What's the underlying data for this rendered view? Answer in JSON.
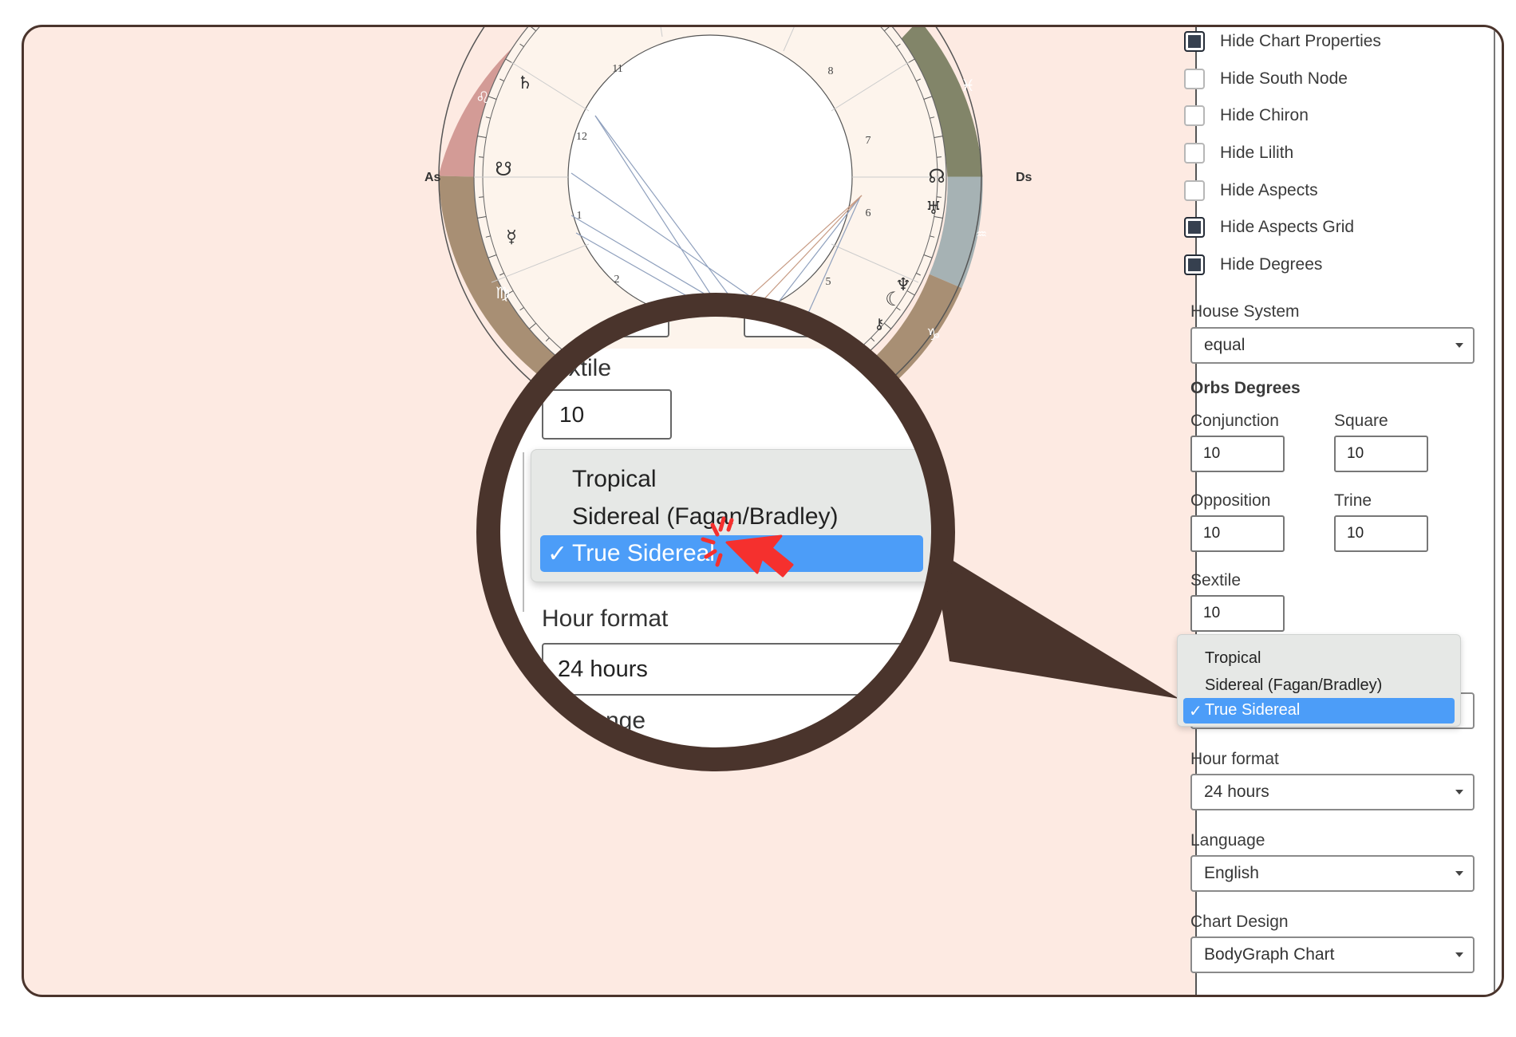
{
  "chart": {
    "asc_label": "As",
    "desc_label": "Ds",
    "house_numbers": [
      "11",
      "12",
      "1",
      "2",
      "8",
      "7",
      "6",
      "5"
    ],
    "signs": {
      "leo": "♌",
      "virgo": "♍",
      "pisces": "♓",
      "aquarius": "♒",
      "capricorn": "♑"
    },
    "planets": {
      "saturn": "♄",
      "south_node": "☋",
      "mercury": "☿",
      "north_node": "☊",
      "uranus": "♅",
      "neptune": "♆",
      "moon": "☾",
      "chiron": "⚷"
    }
  },
  "panel": {
    "checkboxes": [
      {
        "label": "Hide Chart Properties",
        "checked": true
      },
      {
        "label": "Hide South Node",
        "checked": false
      },
      {
        "label": "Hide Chiron",
        "checked": false
      },
      {
        "label": "Hide Lilith",
        "checked": false
      },
      {
        "label": "Hide Aspects",
        "checked": false
      },
      {
        "label": "Hide Aspects Grid",
        "checked": true
      },
      {
        "label": "Hide Degrees",
        "checked": true
      }
    ],
    "house_system": {
      "label": "House System",
      "value": "equal"
    },
    "orbs": {
      "title": "Orbs Degrees",
      "conjunction": {
        "label": "Conjunction",
        "value": "10"
      },
      "square": {
        "label": "Square",
        "value": "10"
      },
      "opposition": {
        "label": "Opposition",
        "value": "10"
      },
      "trine": {
        "label": "Trine",
        "value": "10"
      },
      "sextile": {
        "label": "Sextile",
        "value": "10"
      }
    },
    "zodiac_dropdown": {
      "options": [
        "Tropical",
        "Sidereal (Fagan/Bradley)",
        "True Sidereal"
      ],
      "selected_prefix": "✓",
      "selected": "True Sidereal"
    },
    "hour_format": {
      "label": "Hour format",
      "value": "24 hours"
    },
    "language": {
      "label": "Language",
      "value": "English"
    },
    "chart_design": {
      "label": "Chart Design",
      "value": "BodyGraph Chart"
    }
  },
  "magnifier": {
    "sextile_label_partial": "extile",
    "sextile_value": "10",
    "options": [
      "Tropical",
      "Sidereal (Fagan/Bradley)"
    ],
    "selected_prefix": "✓",
    "selected": "True Sidereal",
    "hour_format_label": "Hour format",
    "hour_format_value": "24 hours",
    "language_partial": "nge"
  },
  "colors": {
    "frame_border": "#4a342c",
    "frame_bg": "#fdeae2",
    "selection_blue": "#4c9df8",
    "cursor_red": "#f5302e"
  }
}
